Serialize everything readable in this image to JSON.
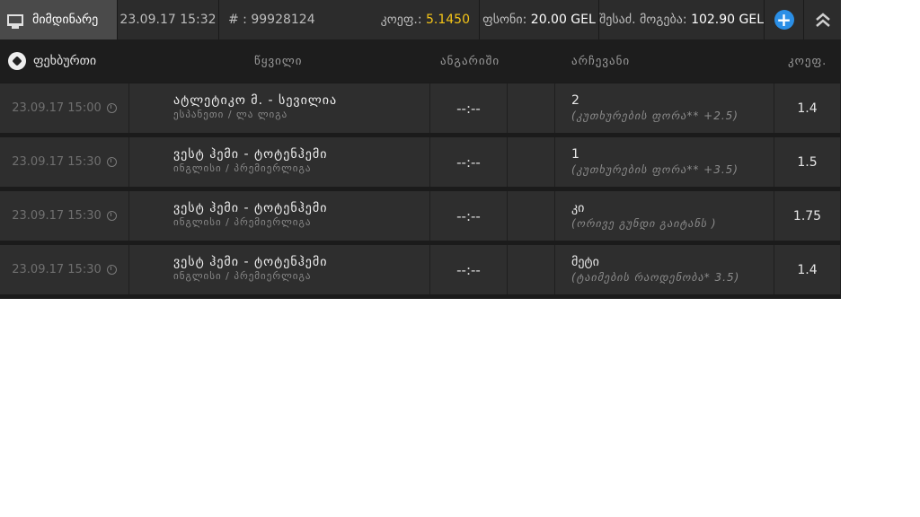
{
  "topbar": {
    "status_label": "მიმდინარე",
    "datetime": "23.09.17 15:32",
    "id_label": "# : 99928124",
    "odds_label": "კოეფ.:",
    "odds_value": "5.1450",
    "stake_label": "ფსონი:",
    "stake_value": "20.00 GEL",
    "win_label": "შესაძ. მოგება:",
    "win_value": "102.90 GEL",
    "add_icon": "plus-circle-icon",
    "collapse_icon": "double-chevron-up-icon",
    "accent_color": "#f5c518",
    "button_color": "#2b8fe6"
  },
  "header": {
    "sport": "ფეხბურთი",
    "pair": "წყვილი",
    "score": "ანგარიში",
    "pick": "არჩევანი",
    "odds": "კოეფ."
  },
  "bets": [
    {
      "time": "23.09.17 15:00",
      "match": "ატლეტიკო მ. - სევილია",
      "league": "ესპანეთი / ლა ლიგა",
      "score": "--:--",
      "pick": "2",
      "pick_detail": "(კუთხურების ფორა** +2.5)",
      "odds": "1.4"
    },
    {
      "time": "23.09.17 15:30",
      "match": "ვესტ ჰემი - ტოტენჰემი",
      "league": "ინგლისი / პრემიერლიგა",
      "score": "--:--",
      "pick": "1",
      "pick_detail": "(კუთხურების ფორა** +3.5)",
      "odds": "1.5"
    },
    {
      "time": "23.09.17 15:30",
      "match": "ვესტ ჰემი - ტოტენჰემი",
      "league": "ინგლისი / პრემიერლიგა",
      "score": "--:--",
      "pick": "კი",
      "pick_detail": "(ორივე გუნდი გაიტანს )",
      "odds": "1.75"
    },
    {
      "time": "23.09.17 15:30",
      "match": "ვესტ ჰემი - ტოტენჰემი",
      "league": "ინგლისი / პრემიერლიგა",
      "score": "--:--",
      "pick": "მეტი",
      "pick_detail": "(ტაიმების რაოდენობა* 3.5)",
      "odds": "1.4"
    }
  ]
}
